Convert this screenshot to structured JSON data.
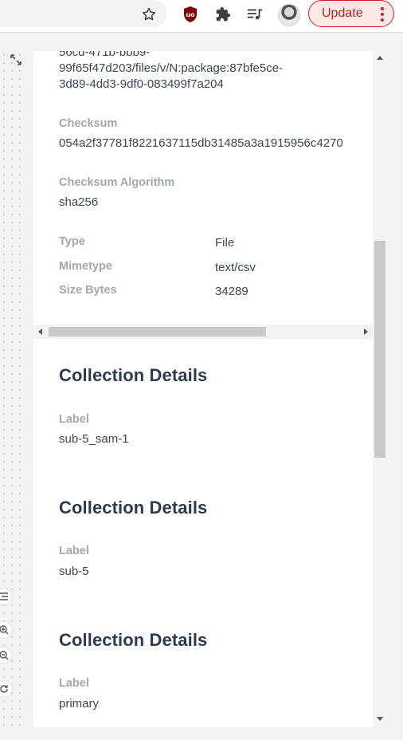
{
  "toolbar": {
    "update_label": "Update",
    "icons": [
      "star-icon",
      "ublock-icon",
      "extensions-icon",
      "reading-list-icon",
      "profile-avatar",
      "menu-dots-icon"
    ]
  },
  "details": {
    "path_line1": "56cd-471b-bbb9-",
    "path_line2": "99f65f47d203/files/v/N:package:87bfe5ce-",
    "path_line3": "3d89-4dd3-9df0-083499f7a204",
    "checksum_label": "Checksum",
    "checksum_value": "054a2f37781f8221637115db31485a3a1915956c4270",
    "algorithm_label": "Checksum Algorithm",
    "algorithm_value": "sha256",
    "type_label": "Type",
    "type_value": "File",
    "mimetype_label": "Mimetype",
    "mimetype_value": "text/csv",
    "size_label": "Size Bytes",
    "size_value": "34289"
  },
  "collections": [
    {
      "heading": "Collection Details",
      "label": "Label",
      "value": "sub-5_sam-1"
    },
    {
      "heading": "Collection Details",
      "label": "Label",
      "value": "sub-5"
    },
    {
      "heading": "Collection Details",
      "label": "Label",
      "value": "primary"
    }
  ]
}
